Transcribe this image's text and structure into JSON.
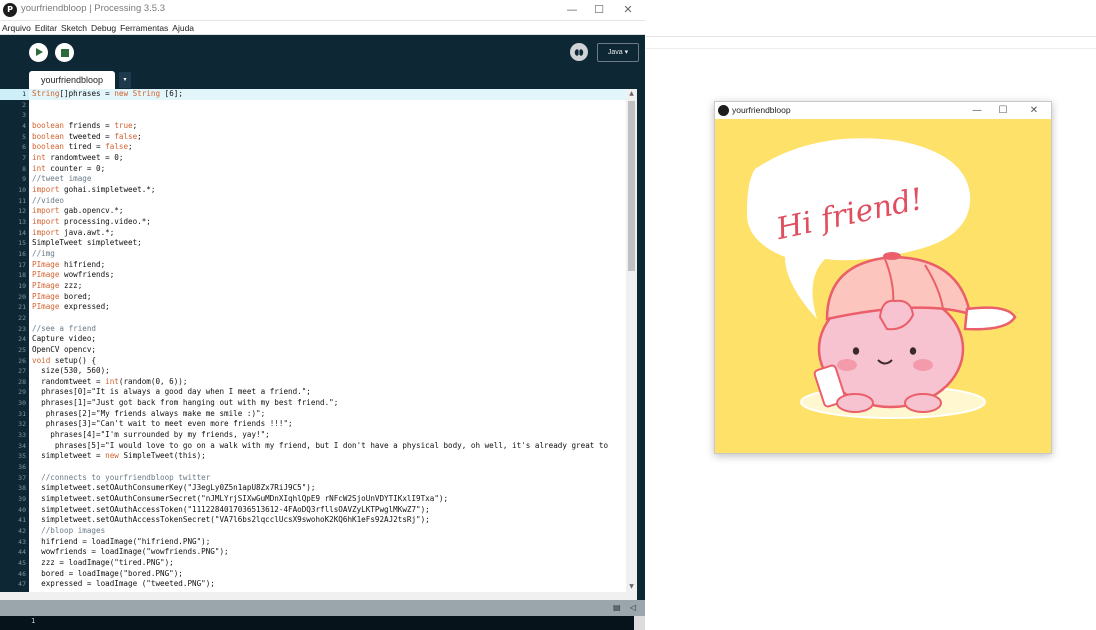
{
  "ide": {
    "title": "yourfriendbloop | Processing 3.5.3",
    "window_buttons": [
      "—",
      "☐",
      "✕"
    ],
    "menu": [
      "Arquivo",
      "Editar",
      "Sketch",
      "Debug",
      "Ferramentas",
      "Ajuda"
    ],
    "toolbar": {
      "run_icon": "play-icon",
      "stop_icon": "stop-icon",
      "debug_icon": "debug-icon",
      "mode_label": "Java ▾"
    },
    "tab": {
      "label": "yourfriendbloop",
      "arrow": "▾"
    },
    "console_line": "1",
    "colors": {
      "toolbar_bg": "#0e2735",
      "run_button_fg": "#2b6b3c",
      "keyword": "#d1632f",
      "comment": "#6a7a86",
      "string": "#7b4f9b"
    }
  },
  "editor": {
    "current_line": 1,
    "lines": [
      {
        "n": "1",
        "t": "String[]phrases = new String [6];"
      },
      {
        "n": "2",
        "t": ""
      },
      {
        "n": "3",
        "t": ""
      },
      {
        "n": "4",
        "t": "boolean friends = true;"
      },
      {
        "n": "5",
        "t": "boolean tweeted = false;"
      },
      {
        "n": "6",
        "t": "boolean tired = false;"
      },
      {
        "n": "7",
        "t": "int randomtweet = 0;"
      },
      {
        "n": "8",
        "t": "int counter = 0;"
      },
      {
        "n": "9",
        "t": "//tweet image"
      },
      {
        "n": "10",
        "t": "import gohai.simpletweet.*;"
      },
      {
        "n": "11",
        "t": "//video"
      },
      {
        "n": "12",
        "t": "import gab.opencv.*;"
      },
      {
        "n": "13",
        "t": "import processing.video.*;"
      },
      {
        "n": "14",
        "t": "import java.awt.*;"
      },
      {
        "n": "15",
        "t": "SimpleTweet simpletweet;"
      },
      {
        "n": "16",
        "t": "//img"
      },
      {
        "n": "17",
        "t": "PImage hifriend;"
      },
      {
        "n": "18",
        "t": "PImage wowfriends;"
      },
      {
        "n": "19",
        "t": "PImage zzz;"
      },
      {
        "n": "20",
        "t": "PImage bored;"
      },
      {
        "n": "21",
        "t": "PImage expressed;"
      },
      {
        "n": "22",
        "t": ""
      },
      {
        "n": "23",
        "t": "//see a friend"
      },
      {
        "n": "24",
        "t": "Capture video;"
      },
      {
        "n": "25",
        "t": "OpenCV opencv;"
      },
      {
        "n": "26",
        "t": "void setup() {"
      },
      {
        "n": "27",
        "t": "  size(530, 560);"
      },
      {
        "n": "28",
        "t": "  randomtweet = int(random(0, 6));"
      },
      {
        "n": "29",
        "t": "  phrases[0]=\"It is always a good day when I meet a friend.\";"
      },
      {
        "n": "30",
        "t": "  phrases[1]=\"Just got back from hanging out with my best friend.\";"
      },
      {
        "n": "31",
        "t": "   phrases[2]=\"My friends always make me smile :)\";"
      },
      {
        "n": "32",
        "t": "   phrases[3]=\"Can't wait to meet even more friends !!!\";"
      },
      {
        "n": "33",
        "t": "    phrases[4]=\"I'm surrounded by my friends, yay!\";"
      },
      {
        "n": "34",
        "t": "     phrases[5]=\"I would love to go on a walk with my friend, but I don't have a physical body, oh well, it's already great to"
      },
      {
        "n": "35",
        "t": "  simpletweet = new SimpleTweet(this);"
      },
      {
        "n": "36",
        "t": ""
      },
      {
        "n": "37",
        "t": "  //connects to yourfriendbloop twitter"
      },
      {
        "n": "38",
        "t": "  simpletweet.setOAuthConsumerKey(\"J3egLy0Z5n1apU8Zx7RiJ9C5\");"
      },
      {
        "n": "39",
        "t": "  simpletweet.setOAuthConsumerSecret(\"nJMLYrjSIXwGuMDnXIqhlQpE9 rNFcW2SjoUnVDYTIKxlI9Txa\");"
      },
      {
        "n": "40",
        "t": "  simpletweet.setOAuthAccessToken(\"1112284017036513612-4FAoDQ3rfllsOAVZyLKTPwglMKwZ7\");"
      },
      {
        "n": "41",
        "t": "  simpletweet.setOAuthAccessTokenSecret(\"VA7l6bs2lqcclUcsX9swohoK2KQ6hK1eFs92AJ2tsRj\");"
      },
      {
        "n": "42",
        "t": "  //bloop images"
      },
      {
        "n": "43",
        "t": "  hifriend = loadImage(\"hifriend.PNG\");"
      },
      {
        "n": "44",
        "t": "  wowfriends = loadImage(\"wowfriends.PNG\");"
      },
      {
        "n": "45",
        "t": "  zzz = loadImage(\"tired.PNG\");"
      },
      {
        "n": "46",
        "t": "  bored = loadImage(\"bored.PNG\");"
      },
      {
        "n": "47",
        "t": "  expressed = loadImage (\"tweeted.PNG\");"
      }
    ]
  },
  "status_icons": [
    "console-icon",
    "error-icon"
  ],
  "sketch": {
    "title": "yourfriendbloop",
    "window_buttons": [
      "—",
      "☐",
      "✕"
    ],
    "speech_text": "Hi friend!",
    "colors": {
      "background": "#fde168",
      "character": "#f7b9c8",
      "cap": "#fcc7bf",
      "outline": "#ea5f6a"
    }
  }
}
